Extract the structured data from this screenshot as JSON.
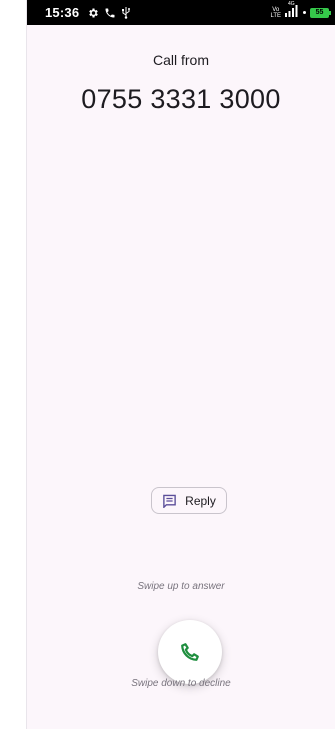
{
  "status_bar": {
    "time": "15:36",
    "net_type_top": "Vo",
    "net_type_bottom": "LTE",
    "net_gen": "4G",
    "battery": "55",
    "battery_color": "#35c84a",
    "icons": [
      "settings-icon",
      "phone-icon",
      "usb-icon",
      "signal-icon",
      "battery-icon"
    ]
  },
  "call": {
    "from_label": "Call from",
    "number": "0755 3331 3000"
  },
  "reply_button": {
    "label": "Reply",
    "icon": "message-icon"
  },
  "hints": {
    "swipe_up": "Swipe up to answer",
    "swipe_down": "Swipe down to decline"
  },
  "answer_button": {
    "icon": "phone-icon",
    "color": "#1e8e3e"
  }
}
